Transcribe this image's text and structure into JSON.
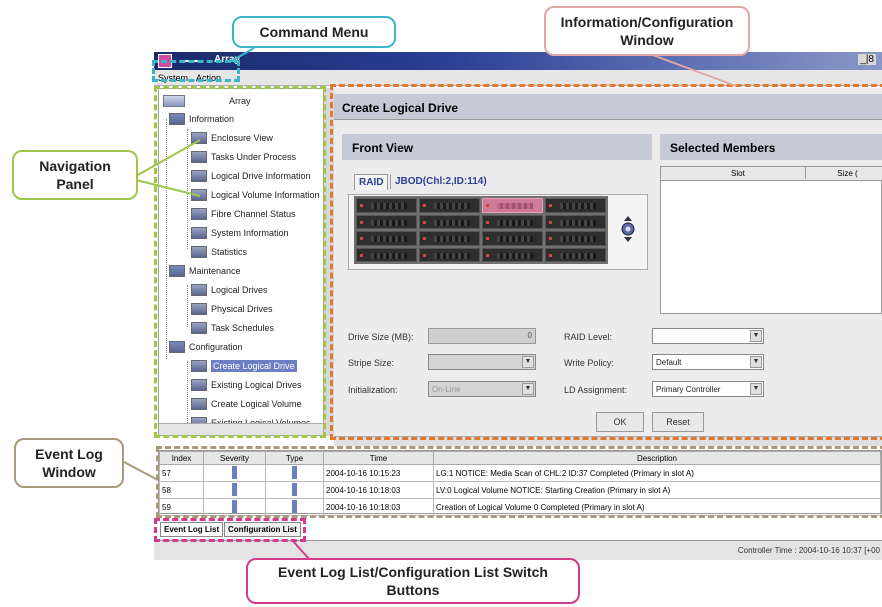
{
  "window": {
    "title": "Array",
    "window_buttons": "_|8",
    "menu": [
      "System",
      "Action"
    ]
  },
  "callouts": {
    "command_menu": "Command Menu",
    "info_config_window": "Information/Configuration Window",
    "navigation_panel": "Navigation Panel",
    "event_log_window": "Event Log Window",
    "switch_buttons": "Event Log List/Configuration List Switch Buttons"
  },
  "nav": {
    "root": "Array",
    "items": [
      {
        "label": "Information",
        "icon": "folder-icon",
        "level": 1
      },
      {
        "label": "Enclosure View",
        "icon": "enclosure-icon",
        "level": 2
      },
      {
        "label": "Tasks Under Process",
        "icon": "tasks-icon",
        "level": 2
      },
      {
        "label": "Logical Drive Information",
        "icon": "logical-drive-icon",
        "level": 2
      },
      {
        "label": "Logical Volume Information",
        "icon": "logical-volume-icon",
        "level": 2
      },
      {
        "label": "Fibre Channel Status",
        "icon": "fibre-channel-icon",
        "level": 2
      },
      {
        "label": "System Information",
        "icon": "system-info-icon",
        "level": 2
      },
      {
        "label": "Statistics",
        "icon": "statistics-icon",
        "level": 2
      },
      {
        "label": "Maintenance",
        "icon": "maintenance-icon",
        "level": 1
      },
      {
        "label": "Logical Drives",
        "icon": "logical-drive-icon",
        "level": 2
      },
      {
        "label": "Physical Drives",
        "icon": "physical-drive-icon",
        "level": 2
      },
      {
        "label": "Task Schedules",
        "icon": "schedule-icon",
        "level": 2
      },
      {
        "label": "Configuration",
        "icon": "configuration-icon",
        "level": 1
      },
      {
        "label": "Create Logical Drive",
        "icon": "create-drive-icon",
        "level": 2,
        "selected": true
      },
      {
        "label": "Existing Logical Drives",
        "icon": "existing-drives-icon",
        "level": 2
      },
      {
        "label": "Create Logical Volume",
        "icon": "create-volume-icon",
        "level": 2
      },
      {
        "label": "Existing Logical Volumes",
        "icon": "existing-volumes-icon",
        "level": 2
      }
    ]
  },
  "content": {
    "title": "Create Logical Drive",
    "front_view": "Front View",
    "tabs": [
      "RAID",
      "JBOD(Chl:2,ID:114)"
    ],
    "selected_members": "Selected Members",
    "members_cols": [
      "Slot",
      "Size ("
    ],
    "form": {
      "drive_size_label": "Drive Size (MB):",
      "drive_size_value": "0",
      "stripe_size_label": "Stripe Size:",
      "initialization_label": "Initialization:",
      "initialization_value": "On-Line",
      "raid_level_label": "RAID Level:",
      "write_policy_label": "Write Policy:",
      "write_policy_value": "Default",
      "ld_assignment_label": "LD Assignment:",
      "ld_assignment_value": "Primary Controller"
    },
    "ok": "OK",
    "reset": "Reset"
  },
  "eventlog": {
    "columns": [
      "Index",
      "Severity",
      "Type",
      "Time",
      "Description"
    ],
    "rows": [
      {
        "index": "57",
        "time": "2004-10-16 10:15:23",
        "desc": "LG:1 NOTICE: Media Scan of CHL:2 ID:37 Completed (Primary in slot A)"
      },
      {
        "index": "58",
        "time": "2004-10-16 10:18:03",
        "desc": "LV:0 Logical Volume NOTICE: Starting Creation (Primary in slot A)"
      },
      {
        "index": "59",
        "time": "2004-10-16 10:18:03",
        "desc": "Creation of Logical Volume 0 Completed (Primary in slot A)"
      }
    ],
    "tabs": [
      "Event Log List",
      "Configuration List"
    ]
  },
  "status": "Controller Time : 2004-10-16 10:37 [+00",
  "colors": {
    "callout_border": "#e0a8a8",
    "dash_orange": "#e07a30",
    "dash_green": "#9ec64a",
    "dash_cyan": "#3ab6c8",
    "dash_magenta": "#d23a8a",
    "callout_cyan": "#3ab6c8"
  }
}
